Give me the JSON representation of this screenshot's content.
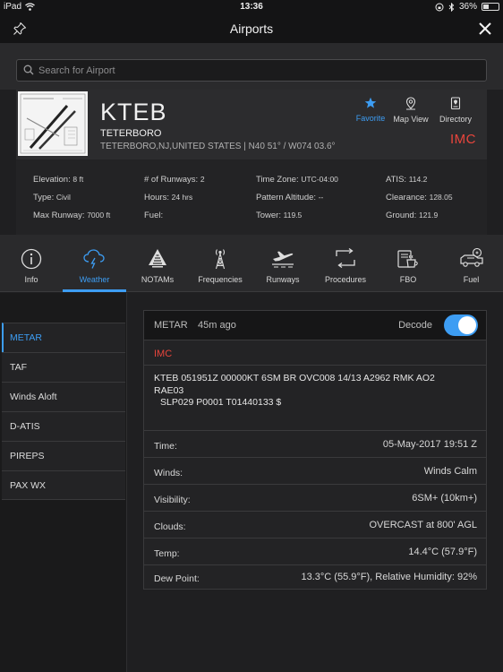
{
  "status_bar": {
    "device": "iPad",
    "time": "13:36",
    "battery": "36%",
    "battery_level": 0.36
  },
  "header": {
    "title": "Airports"
  },
  "search": {
    "placeholder": "Search for Airport"
  },
  "airport": {
    "ident": "KTEB",
    "name": "TETERBORO",
    "location": "TETERBORO,NJ,UNITED STATES | N40 51° / W074 03.6°",
    "flight_category": "IMC",
    "actions": {
      "favorite": "Favorite",
      "map_view": "Map View",
      "directory": "Directory"
    },
    "details": {
      "elevation_label": "Elevation:",
      "elevation_value": "8 ft",
      "type_label": "Type:",
      "type_value": "Civil",
      "max_runway_label": "Max Runway:",
      "max_runway_value": "7000 ft",
      "runways_label": "# of Runways:",
      "runways_value": "2",
      "hours_label": "Hours:",
      "hours_value": "24 hrs",
      "fuel_label": "Fuel:",
      "fuel_value": "",
      "timezone_label": "Time Zone:",
      "timezone_value": "UTC-04:00",
      "pattern_label": "Pattern Altitude:",
      "pattern_value": "--",
      "tower_label": "Tower:",
      "tower_value": "119.5",
      "atis_label": "ATIS:",
      "atis_value": "114.2",
      "clearance_label": "Clearance:",
      "clearance_value": "128.05",
      "ground_label": "Ground:",
      "ground_value": "121.9"
    }
  },
  "tabs": [
    {
      "label": "Info",
      "icon": "info-icon"
    },
    {
      "label": "Weather",
      "icon": "weather-icon"
    },
    {
      "label": "NOTAMs",
      "icon": "notam-icon"
    },
    {
      "label": "Frequencies",
      "icon": "antenna-icon"
    },
    {
      "label": "Runways",
      "icon": "runway-icon"
    },
    {
      "label": "Procedures",
      "icon": "procedures-icon"
    },
    {
      "label": "FBO",
      "icon": "fbo-icon"
    },
    {
      "label": "Fuel",
      "icon": "fuel-icon"
    }
  ],
  "active_tab": "Weather",
  "sidebar": {
    "items": [
      {
        "label": "METAR"
      },
      {
        "label": "TAF"
      },
      {
        "label": "Winds Aloft"
      },
      {
        "label": "D-ATIS"
      },
      {
        "label": "PIREPS"
      },
      {
        "label": "PAX WX"
      }
    ],
    "active": "METAR"
  },
  "metar": {
    "title": "METAR",
    "age": "45m ago",
    "decode_label": "Decode",
    "decode_on": true,
    "category": "IMC",
    "raw_line1": "KTEB 051951Z 00000KT 6SM BR OVC008 14/13 A2962 RMK AO2",
    "raw_line2": "RAE03",
    "raw_line3": "SLP029 P0001 T01440133 $",
    "rows": [
      {
        "label": "Time:",
        "value": "05-May-2017 19:51 Z"
      },
      {
        "label": "Winds:",
        "value": "Winds Calm"
      },
      {
        "label": "Visibility:",
        "value": "6SM+ (10km+)"
      },
      {
        "label": "Clouds:",
        "value": "OVERCAST at 800' AGL"
      },
      {
        "label": "Temp:",
        "value": "14.4°C (57.9°F)"
      },
      {
        "label": "Dew Point:",
        "value": "13.3°C (55.9°F), Relative Humidity: 92%"
      }
    ]
  },
  "colors": {
    "accent": "#3d9df3",
    "imc": "#e8453c"
  }
}
